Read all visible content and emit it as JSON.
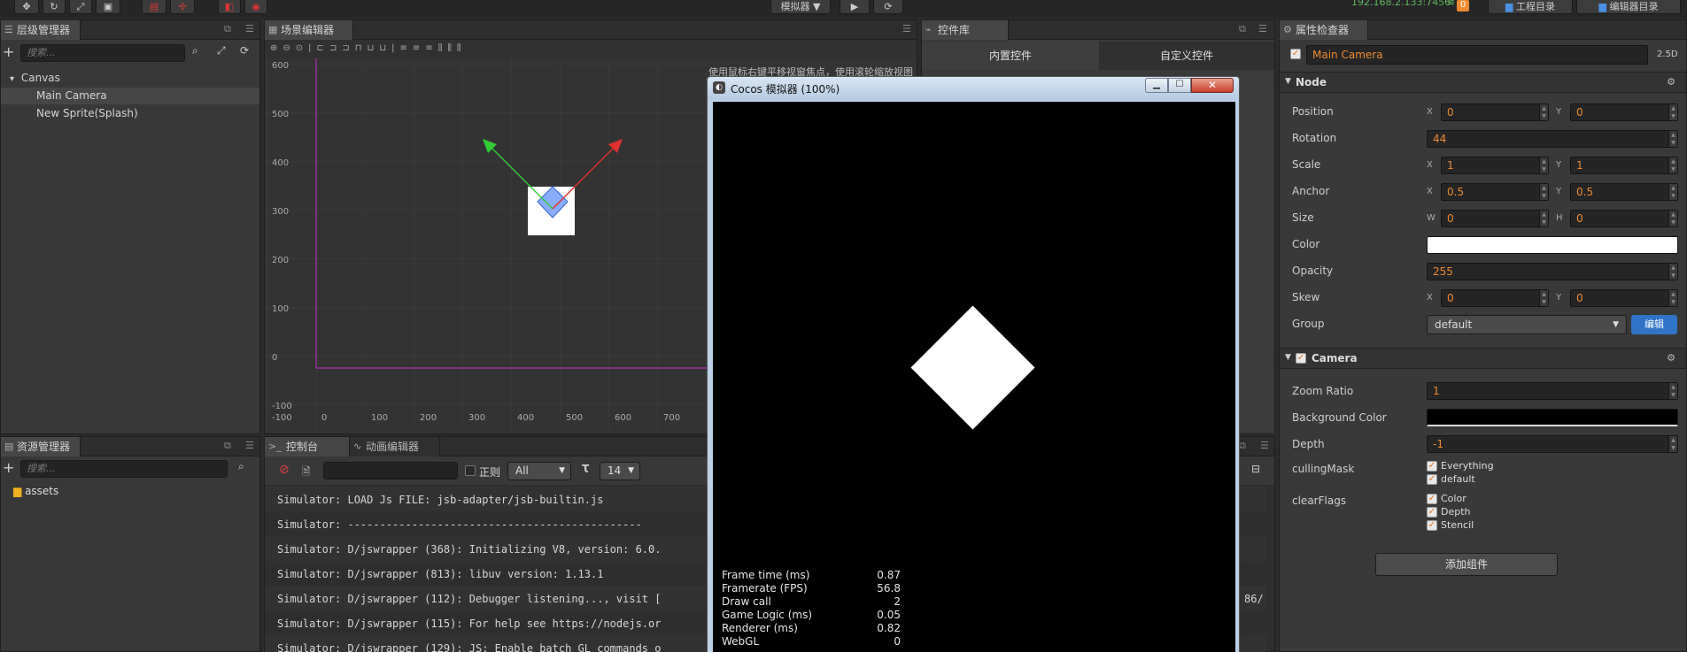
{
  "topbar": {
    "simulator_label": "模拟器 ▼",
    "ip": "192.168.2.133:7456",
    "badge": "0",
    "project_dir": "工程目录",
    "editor_dir": "编辑器目录"
  },
  "hierarchy": {
    "title": "层级管理器",
    "search_placeholder": "搜索...",
    "items": [
      {
        "label": "Canvas",
        "arrow": "▾"
      },
      {
        "label": "Main Camera"
      },
      {
        "label": "New Sprite(Splash)"
      }
    ]
  },
  "scene": {
    "title": "场景编辑器",
    "hint": "使用鼠标右键平移视窗焦点，使用滚轮缩放视图",
    "y_ticks": [
      "600",
      "500",
      "400",
      "300",
      "200",
      "100",
      "0",
      "-100"
    ],
    "x_ticks": [
      "-100",
      "0",
      "100",
      "200",
      "300",
      "400",
      "500",
      "600",
      "700"
    ]
  },
  "widgets": {
    "title": "控件库",
    "tab_builtin": "内置控件",
    "tab_custom": "自定义控件"
  },
  "assets": {
    "title": "资源管理器",
    "search_placeholder": "搜索...",
    "root": "assets"
  },
  "console": {
    "tab_console": "控制台",
    "tab_anim": "动画编辑器",
    "regex_label": "正则",
    "level": "All",
    "font_size": "14",
    "lines": [
      "Simulator: LOAD Js FILE: jsb-adapter/jsb-builtin.js",
      "Simulator: ----------------------------------------------",
      "Simulator: D/jswrapper (368): Initializing V8, version: 6.0.",
      "Simulator: D/jswrapper (813): libuv version: 1.13.1",
      "Simulator: D/jswrapper (112): Debugger listening..., visit [",
      "Simulator: D/jswrapper (115): For help see https://nodejs.or",
      "Simulator: D/jswrapper (129): JS: Enable batch GL commands o"
    ],
    "right_fragment": "86/"
  },
  "simulator": {
    "title": "Cocos 模拟器 (100%)",
    "stats": [
      {
        "label": "Frame time (ms)",
        "value": "0.87"
      },
      {
        "label": "Framerate (FPS)",
        "value": "56.8"
      },
      {
        "label": "Draw call",
        "value": "2"
      },
      {
        "label": "Game Logic (ms)",
        "value": "0.05"
      },
      {
        "label": "Renderer (ms)",
        "value": "0.82"
      },
      {
        "label": "WebGL",
        "value": "0"
      }
    ]
  },
  "inspector": {
    "title": "属性检查器",
    "node_name": "Main Camera",
    "mode": "2.5D",
    "node_section": "Node",
    "position_label": "Position",
    "position_x": "0",
    "position_y": "0",
    "rotation_label": "Rotation",
    "rotation": "44",
    "scale_label": "Scale",
    "scale_x": "1",
    "scale_y": "1",
    "anchor_label": "Anchor",
    "anchor_x": "0.5",
    "anchor_y": "0.5",
    "size_label": "Size",
    "size_w": "0",
    "size_h": "0",
    "color_label": "Color",
    "color_value": "#ffffff",
    "opacity_label": "Opacity",
    "opacity": "255",
    "skew_label": "Skew",
    "skew_x": "0",
    "skew_y": "0",
    "group_label": "Group",
    "group": "default",
    "edit_button": "编辑",
    "axis_x": "X",
    "axis_y": "Y",
    "axis_w": "W",
    "axis_h": "H",
    "camera_section": "Camera",
    "zoom_label": "Zoom Ratio",
    "zoom": "1",
    "bg_label": "Background Color",
    "bg_value": "#000000",
    "depth_label": "Depth",
    "depth": "-1",
    "culling_label": "cullingMask",
    "culling_items": [
      "Everything",
      "default"
    ],
    "clear_label": "clearFlags",
    "clear_items": [
      "Color",
      "Depth",
      "Stencil"
    ],
    "add_component": "添加组件"
  }
}
